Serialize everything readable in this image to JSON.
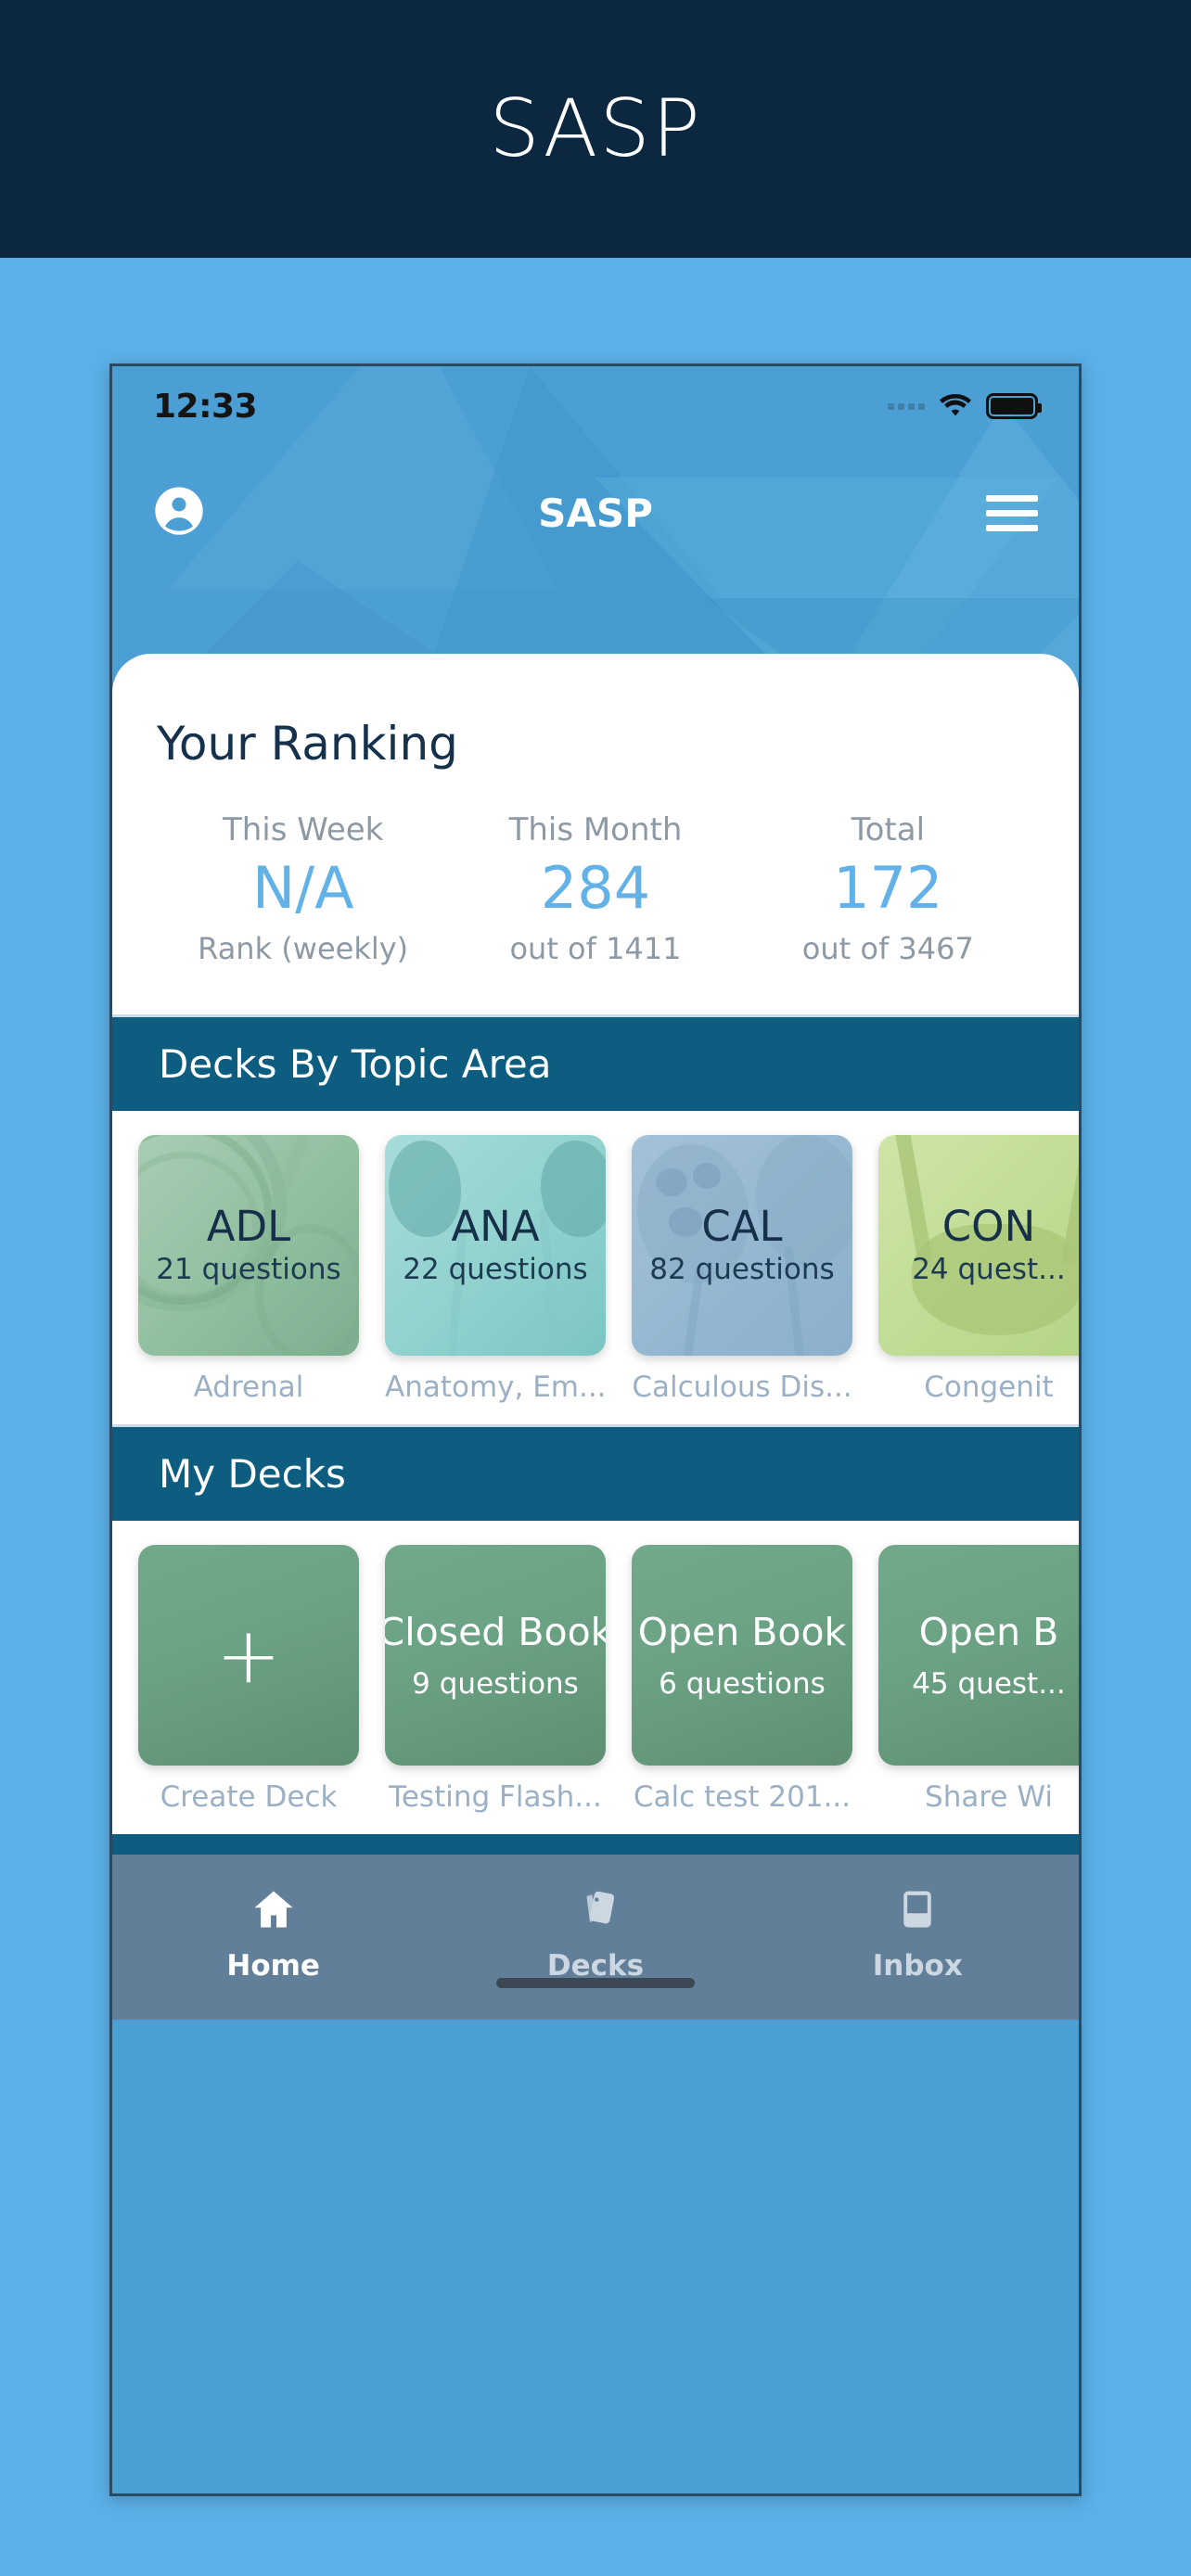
{
  "banner": {
    "title": "SASP"
  },
  "status_bar": {
    "time": "12:33",
    "wifi_icon": "wifi-icon",
    "battery_icon": "battery-icon",
    "signal_icon": "signal-dots-icon"
  },
  "app_bar": {
    "title": "SASP",
    "account_icon": "account-circle-icon",
    "menu_icon": "hamburger-menu-icon"
  },
  "ranking": {
    "title": "Your Ranking",
    "stats": [
      {
        "label": "This Week",
        "value": "N/A",
        "sub": "Rank (weekly)"
      },
      {
        "label": "This Month",
        "value": "284",
        "sub": "out of 1411"
      },
      {
        "label": "Total",
        "value": "172",
        "sub": "out of 3467"
      }
    ]
  },
  "topic_section": {
    "header": "Decks By Topic Area",
    "cards": [
      {
        "code": "ADL",
        "questions": "21 questions",
        "caption": "Adrenal"
      },
      {
        "code": "ANA",
        "questions": "22 questions",
        "caption": "Anatomy, Em..."
      },
      {
        "code": "CAL",
        "questions": "82 questions",
        "caption": "Calculous Dis..."
      },
      {
        "code": "CON",
        "questions": "24 quest...",
        "caption": "Congenit"
      }
    ]
  },
  "my_decks_section": {
    "header": "My Decks",
    "cards": [
      {
        "code": "+",
        "questions": "",
        "caption": "Create Deck"
      },
      {
        "code": "Closed Book",
        "questions": "9 questions",
        "caption": "Testing Flash..."
      },
      {
        "code": "Open Book",
        "questions": "6 questions",
        "caption": "Calc test 201..."
      },
      {
        "code": "Open B",
        "questions": "45 quest...",
        "caption": "Share Wi"
      }
    ]
  },
  "tab_bar": {
    "tabs": [
      {
        "label": "Home",
        "icon": "home-icon",
        "active": true
      },
      {
        "label": "Decks",
        "icon": "cards-icon",
        "active": false
      },
      {
        "label": "Inbox",
        "icon": "inbox-icon",
        "active": false
      }
    ]
  },
  "colors": {
    "banner_bg": "#0c2740",
    "page_bg": "#5bb0e8",
    "section_header_bg": "#0d5d80",
    "accent_blue": "#62b2e8",
    "tabbar_bg": "#617f99",
    "deck_green": "#6ba283"
  }
}
